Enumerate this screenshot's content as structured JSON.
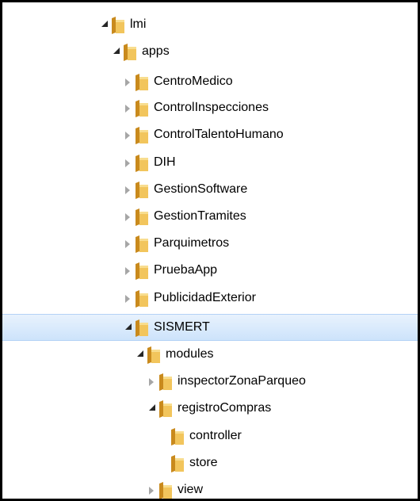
{
  "tree": [
    {
      "label": "lmi",
      "state": "expanded"
    },
    {
      "label": "apps",
      "state": "expanded"
    },
    {
      "label": "CentroMedico",
      "state": "collapsed"
    },
    {
      "label": "ControlInspecciones",
      "state": "collapsed"
    },
    {
      "label": "ControlTalentoHumano",
      "state": "collapsed"
    },
    {
      "label": "DIH",
      "state": "collapsed"
    },
    {
      "label": "GestionSoftware",
      "state": "collapsed"
    },
    {
      "label": "GestionTramites",
      "state": "collapsed"
    },
    {
      "label": "Parquimetros",
      "state": "collapsed"
    },
    {
      "label": "PruebaApp",
      "state": "collapsed"
    },
    {
      "label": "PublicidadExterior",
      "state": "collapsed"
    },
    {
      "label": "SISMERT",
      "state": "expanded",
      "selected": true
    },
    {
      "label": "modules",
      "state": "expanded"
    },
    {
      "label": "inspectorZonaParqueo",
      "state": "collapsed"
    },
    {
      "label": "registroCompras",
      "state": "expanded"
    },
    {
      "label": "controller",
      "state": "leaf"
    },
    {
      "label": "store",
      "state": "leaf"
    },
    {
      "label": "view",
      "state": "collapsed"
    }
  ],
  "colors": {
    "selection": "#cde3fb",
    "folder": "#e8b84a",
    "expanded_arrow": "#262626",
    "collapsed_arrow": "#a6a6a6"
  },
  "icons": {
    "folder": "folder-icon",
    "expanded": "expanded-arrow-icon",
    "collapsed": "collapsed-arrow-icon"
  }
}
